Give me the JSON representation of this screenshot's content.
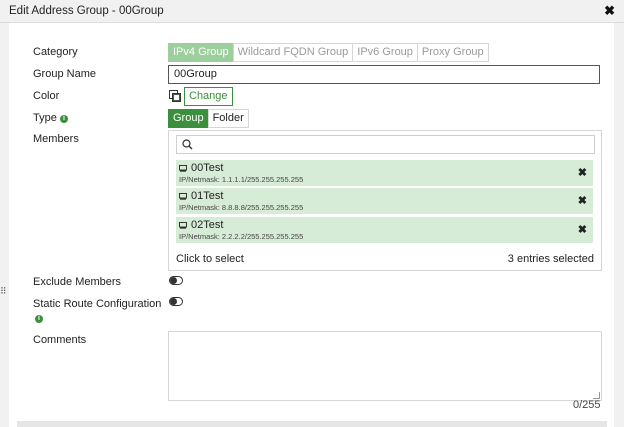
{
  "window": {
    "title": "Edit Address Group - 00Group",
    "close_label": "✖"
  },
  "form": {
    "category_label": "Category",
    "category_options": [
      "IPv4 Group",
      "Wildcard FQDN Group",
      "IPv6 Group",
      "Proxy Group"
    ],
    "group_name_label": "Group Name",
    "group_name_value": "00Group",
    "color_label": "Color",
    "change_label": "Change",
    "type_label": "Type",
    "type_options": [
      "Group",
      "Folder"
    ],
    "members_label": "Members",
    "members": [
      {
        "name": "00Test",
        "subnet": "IP/Netmask: 1.1.1.1/255.255.255.255"
      },
      {
        "name": "01Test",
        "subnet": "IP/Netmask: 8.8.8.8/255.255.255.255"
      },
      {
        "name": "02Test",
        "subnet": "IP/Netmask: 2.2.2.2/255.255.255.255"
      }
    ],
    "remove_label": "✖",
    "click_to_select": "Click to select",
    "entries_selected": "3 entries selected",
    "exclude_members_label": "Exclude Members",
    "static_route_label": "Static Route Configuration",
    "comments_label": "Comments",
    "comments_counter": "0/255"
  },
  "colors": {
    "accent": "#3c8f3c",
    "accent_light": "#9ccf9c",
    "member_bg": "#d7ecd7"
  }
}
